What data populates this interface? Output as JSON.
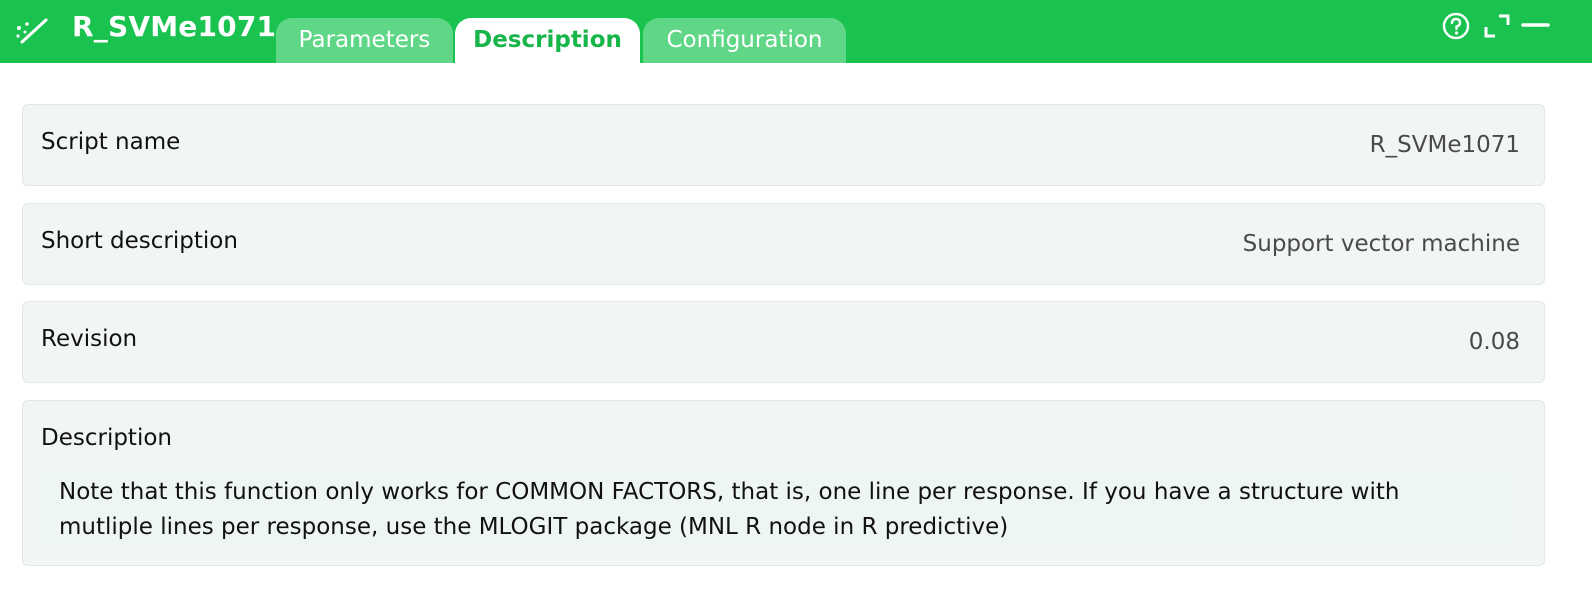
{
  "header": {
    "title": "R_SVMe1071",
    "icon": "magic-wand-icon",
    "tabs": [
      {
        "label": "Parameters",
        "active": false
      },
      {
        "label": "Description",
        "active": true
      },
      {
        "label": "Configuration",
        "active": false
      }
    ],
    "window_controls": [
      "help-icon",
      "expand-icon",
      "minimize-icon"
    ],
    "colors": {
      "bar": "#1ac34f",
      "inactive_tab": "#5fd786",
      "active_tab_text": "#18b54a"
    }
  },
  "fields": {
    "script_name": {
      "label": "Script name",
      "value": "R_SVMe1071"
    },
    "short_description": {
      "label": "Short description",
      "value": "Support vector machine"
    },
    "revision": {
      "label": "Revision",
      "value": "0.08"
    },
    "description": {
      "label": "Description",
      "text": "Note that this function only works for COMMON FACTORS, that is, one line per response. If you have a structure with mutliple lines per response, use the MLOGIT package (MNL R node in R predictive)"
    }
  }
}
